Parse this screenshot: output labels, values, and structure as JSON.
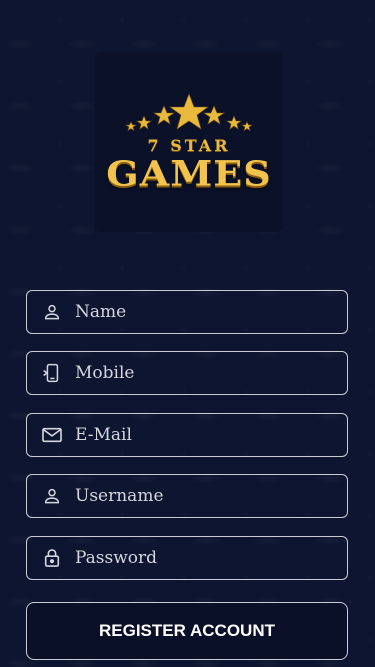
{
  "logo": {
    "line1": "7 STAR",
    "line2": "GAMES",
    "gold": "#f2c44d"
  },
  "form": {
    "fields": [
      {
        "placeholder": "Name",
        "icon": "person-icon"
      },
      {
        "placeholder": "Mobile",
        "icon": "mobile-icon"
      },
      {
        "placeholder": "E-Mail",
        "icon": "mail-icon"
      },
      {
        "placeholder": "Username",
        "icon": "person-icon"
      },
      {
        "placeholder": "Password",
        "icon": "lock-icon"
      }
    ],
    "submit_label": "REGISTER ACCOUNT"
  },
  "colors": {
    "background": "#0d1530",
    "border": "#c9ccd6",
    "text": "#ffffff"
  }
}
